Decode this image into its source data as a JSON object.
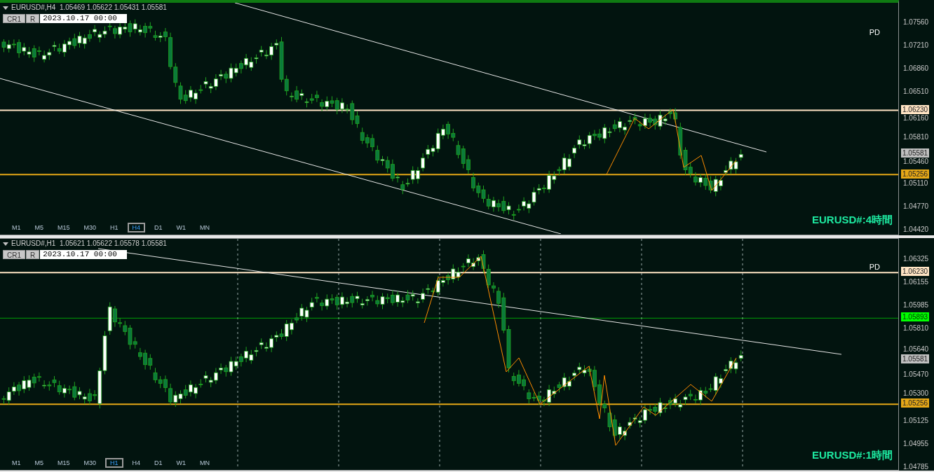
{
  "panels": [
    {
      "active": true,
      "period_separators": false,
      "header": "EURUSD#,H4  1.05469 1.05622 1.05431 1.05581",
      "buttons": [
        "CR1",
        "R"
      ],
      "date": "2023.10.17 00:00",
      "object_label": "PD",
      "chart_label": "EURUSD#:4時間",
      "axis_ticks": [
        "1.07560",
        "1.07210",
        "1.06860",
        "1.06510",
        "1.06160",
        "1.05810",
        "1.05460",
        "1.05110",
        "1.04770",
        "1.04420"
      ],
      "levels": [
        {
          "kind": "line",
          "label": "1.06230",
          "color": "#ffe4c4"
        },
        {
          "kind": "bid",
          "label": "1.05581",
          "color": "#c0c0c0"
        },
        {
          "kind": "line",
          "label": "1.05256",
          "color": "#e6a817"
        }
      ],
      "timeframes": [
        {
          "label": "M1",
          "selected": false
        },
        {
          "label": "M5",
          "selected": false
        },
        {
          "label": "M15",
          "selected": false
        },
        {
          "label": "M30",
          "selected": false
        },
        {
          "label": "H1",
          "selected": false
        },
        {
          "label": "H4",
          "selected": true
        },
        {
          "label": "D1",
          "selected": false
        },
        {
          "label": "W1",
          "selected": false
        },
        {
          "label": "MN",
          "selected": false
        }
      ]
    },
    {
      "active": false,
      "period_separators": true,
      "header": "EURUSD#,H1  1.05621 1.05622 1.05578 1.05581",
      "buttons": [
        "CR1",
        "R"
      ],
      "date": "2023.10.17 00:00",
      "object_label": "PD",
      "chart_label": "EURUSD#:1時間",
      "axis_ticks": [
        "1.06325",
        "1.06155",
        "1.05985",
        "1.05810",
        "1.05640",
        "1.05470",
        "1.05300",
        "1.05125",
        "1.04955",
        "1.04785"
      ],
      "levels": [
        {
          "kind": "line",
          "label": "1.06230",
          "color": "#ffe4c4"
        },
        {
          "kind": "thin",
          "label": "1.05893",
          "color": "#00ff00"
        },
        {
          "kind": "bid",
          "label": "1.05581",
          "color": "#c0c0c0"
        },
        {
          "kind": "line",
          "label": "1.05256",
          "color": "#e6a817"
        }
      ],
      "timeframes": [
        {
          "label": "M1",
          "selected": false
        },
        {
          "label": "M5",
          "selected": false
        },
        {
          "label": "M15",
          "selected": false
        },
        {
          "label": "M30",
          "selected": false
        },
        {
          "label": "H1",
          "selected": true
        },
        {
          "label": "H4",
          "selected": false
        },
        {
          "label": "D1",
          "selected": false
        },
        {
          "label": "W1",
          "selected": false
        },
        {
          "label": "MN",
          "selected": false
        }
      ]
    }
  ]
}
